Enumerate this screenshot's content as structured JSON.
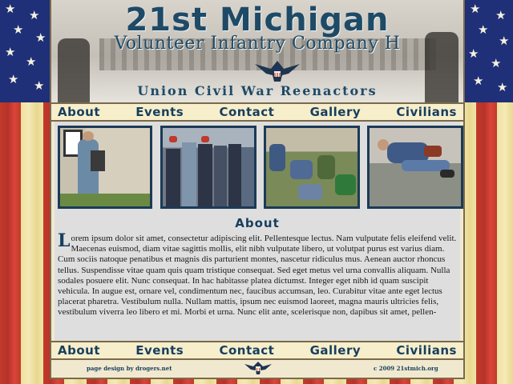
{
  "header": {
    "title": "21st Michigan",
    "subtitle": "Volunteer Infantry Company H",
    "tagline": "Union Civil War Reenactors",
    "eagle_icon": "eagle-emblem-icon"
  },
  "nav": [
    {
      "label": "About"
    },
    {
      "label": "Events"
    },
    {
      "label": "Contact"
    },
    {
      "label": "Gallery"
    },
    {
      "label": "Civilians"
    }
  ],
  "gallery": {
    "thumbnails": [
      {
        "name": "soldier-portrait-photo"
      },
      {
        "name": "company-lineup-photo"
      },
      {
        "name": "camp-rest-photo"
      },
      {
        "name": "reenactment-casualty-photo"
      }
    ]
  },
  "about": {
    "heading": "About",
    "dropcap": "L",
    "body": "orem ipsum dolor sit amet, consectetur adipiscing elit. Pellentesque lectus. Nam vulputate felis eleifend velit. Maecenas euismod, diam vitae sagittis mollis, elit nibh vulputate libero, ut volutpat purus est varius diam. Cum sociis natoque penatibus et magnis dis parturient montes, nascetur ridiculus mus. Aenean auctor rhoncus tellus. Suspendisse vitae quam quis quam tristique consequat. Sed eget metus vel urna convallis aliquam. Nulla sodales posuere elit. Nunc consequat. In hac habitasse platea dictumst. Integer eget nibh id quam suscipit vehicula. In augue est, ornare vel, condimentum nec, faucibus accumsan, leo. Curabitur vitae ante eget lectus placerat pharetra. Vestibulum nulla. Nullam mattis, ipsum nec euismod laoreet, magna mauris ultricies felis, vestibulum viverra leo libero et mi. Morbi et urna. Nunc elit ante, scelerisque non, dapibus sit amet, pellen-"
  },
  "footer": {
    "design_credit": "page design by drogers.net",
    "copyright": "c 2009 21stmich.org"
  },
  "colors": {
    "navy": "#163e5e",
    "flag_blue": "#1f2f78",
    "flag_red": "#c23a2a",
    "parchment": "#f1e9cf"
  }
}
